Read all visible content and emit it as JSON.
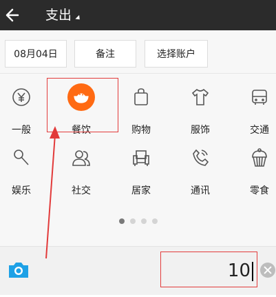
{
  "header": {
    "title": "支出"
  },
  "toolbar": {
    "date_label": "08月04日",
    "note_label": "备注",
    "account_label": "选择账户"
  },
  "categories": {
    "row1": [
      "一般",
      "餐饮",
      "购物",
      "服饰",
      "交通"
    ],
    "row2": [
      "娱乐",
      "社交",
      "居家",
      "通讯",
      "零食"
    ]
  },
  "icons": {
    "general": "yen-coin-icon",
    "food": "rice-bowl-icon",
    "shopping": "shopping-bag-icon",
    "clothes": "shirt-icon",
    "transport": "bus-icon",
    "entertainment": "microphone-icon",
    "social": "people-icon",
    "home": "sofa-icon",
    "phone": "phone-icon",
    "snacks": "cupcake-icon"
  },
  "pagination": {
    "current": 1,
    "total": 4
  },
  "amount": {
    "value": "10"
  },
  "colors": {
    "header_bg": "#2b2b2b",
    "accent_orange": "#ff6a13",
    "camera_blue": "#1ea1e6",
    "annotation_red": "#e23a3a"
  }
}
